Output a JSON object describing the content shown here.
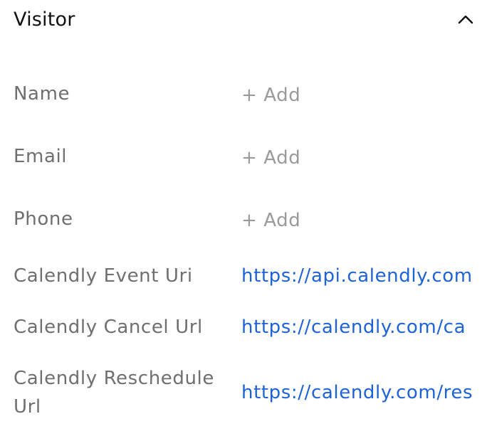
{
  "section": {
    "title": "Visitor",
    "collapse_icon": "chevron-up-icon"
  },
  "fields": {
    "name": {
      "label": "Name",
      "value": "+ Add"
    },
    "email": {
      "label": "Email",
      "value": "+ Add"
    },
    "phone": {
      "label": "Phone",
      "value": "+ Add"
    },
    "event_uri": {
      "label": "Calendly Event Uri",
      "value": "https://api.calendly.com"
    },
    "cancel_url": {
      "label": "Calendly Cancel Url",
      "value": "https://calendly.com/ca"
    },
    "reschedule_url": {
      "label_line1": "Calendly Reschedule",
      "label_line2": "Url",
      "value": "https://calendly.com/res"
    }
  },
  "colors": {
    "label": "#6f6f6f",
    "add": "#9a9a9a",
    "link": "#1e63d6"
  }
}
